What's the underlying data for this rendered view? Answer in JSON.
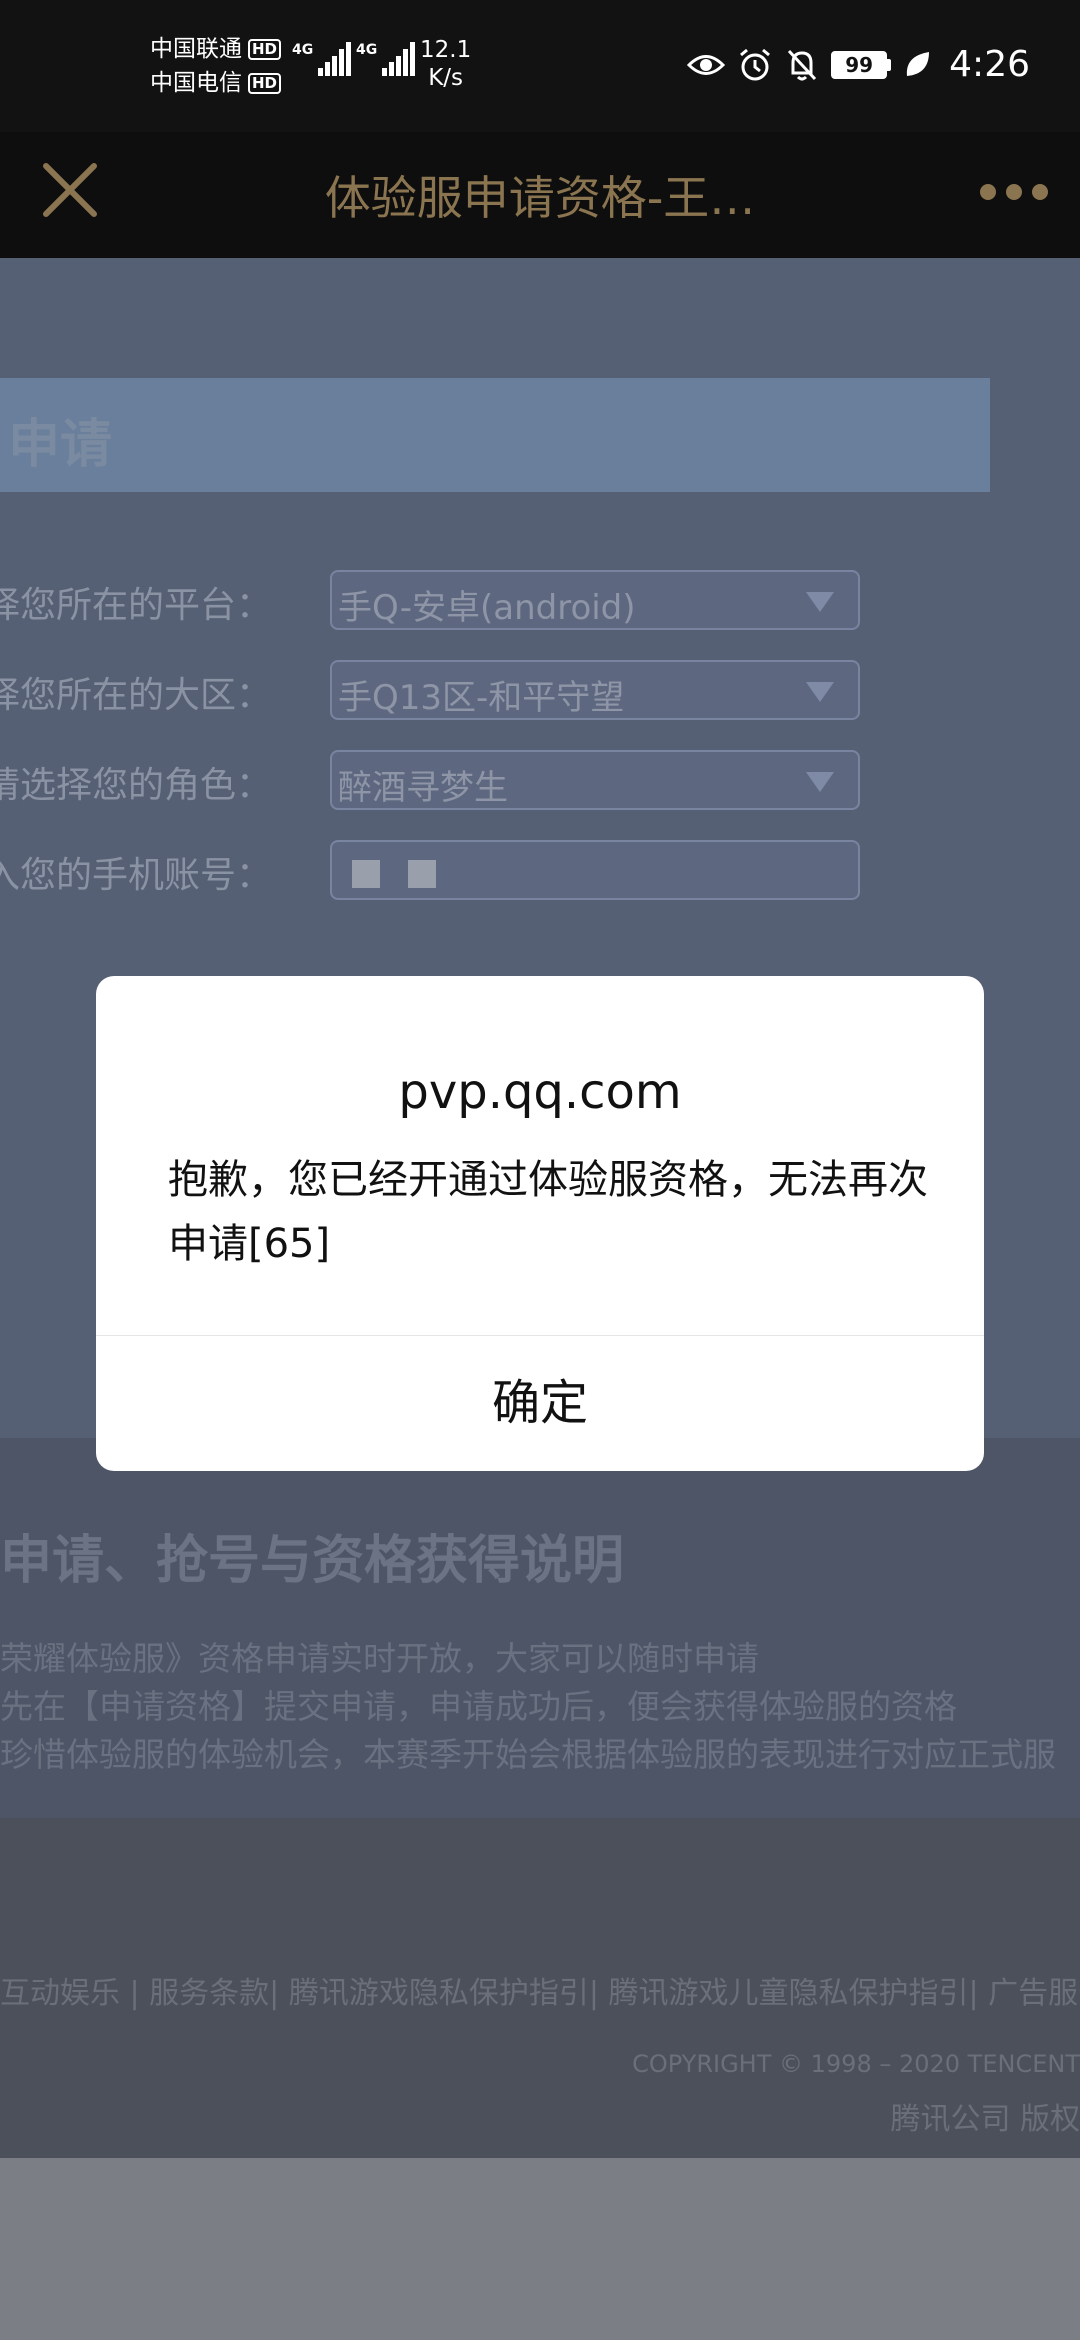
{
  "status_bar": {
    "carrier_1": "中国联通",
    "carrier_2": "中国电信",
    "hd_badge": "HD",
    "network_type": "4G",
    "speed_value": "12.1",
    "speed_unit": "K/s",
    "battery": "99",
    "time": "4:26",
    "icons": [
      "eye-icon",
      "alarm-icon",
      "bell-muted-icon",
      "battery-icon",
      "leaf-icon"
    ]
  },
  "nav": {
    "title": "体验服申请资格-王…",
    "close_icon": "close-icon",
    "more_icon": "more-icon",
    "accent_color": "#8a7550"
  },
  "page": {
    "apply_title": "申请",
    "form": [
      {
        "label": "选择您所在的平台：",
        "value": "手Q-安卓(android)"
      },
      {
        "label": "选择您所在的大区：",
        "value": "手Q13区-和平守望"
      },
      {
        "label": "请选择您的角色：",
        "value": "醉酒寻梦生"
      },
      {
        "label": "输入您的手机账号：",
        "value": ""
      }
    ],
    "info_title": "申请、抢号与资格获得说明",
    "info_lines": [
      "荣耀体验服》资格申请实时开放，大家可以随时申请",
      "先在【申请资格】提交申请，申请成功后，便会获得体验服的资格",
      "珍惜体验服的体验机会，本赛季开始会根据体验服的表现进行对应正式服"
    ],
    "footer_links": "互动娱乐 | 服务条款| 腾讯游戏隐私保护指引| 腾讯游戏儿童隐私保护指引| 广告服务",
    "copyright": "COPYRIGHT © 1998 – 2020 TENCENT",
    "company": "腾讯公司 版权"
  },
  "dialog": {
    "title": "pvp.qq.com",
    "message": "抱歉，您已经开通过体验服资格，无法再次申请[65]",
    "confirm_label": "确定"
  }
}
